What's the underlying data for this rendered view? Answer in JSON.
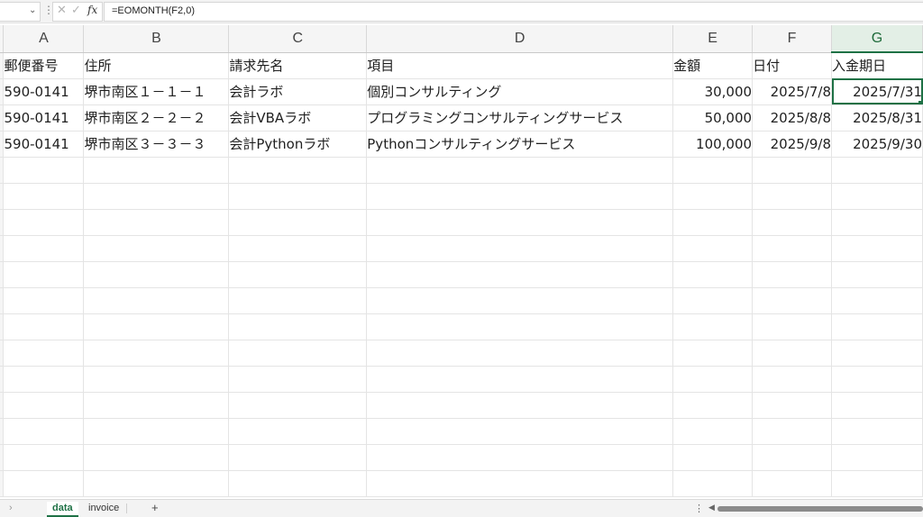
{
  "formula_bar": {
    "name_box": "",
    "formula": "=EOMONTH(F2,0)",
    "fx_label": "fx",
    "cancel_icon": "✕",
    "enter_icon": "✓"
  },
  "columns": [
    "A",
    "B",
    "C",
    "D",
    "E",
    "F",
    "G"
  ],
  "selected_column": "G",
  "headers": {
    "a": "郵便番号",
    "b": "住所",
    "c": "請求先名",
    "d": "項目",
    "e": "金額",
    "f": "日付",
    "g": "入金期日"
  },
  "rows": [
    {
      "a": "590-0141",
      "b": "堺市南区１－１－１",
      "c": "会計ラボ",
      "d": "個別コンサルティング",
      "e": "30,000",
      "f": "2025/7/8",
      "g": "2025/7/31"
    },
    {
      "a": "590-0141",
      "b": "堺市南区２－２－２",
      "c": "会計VBAラボ",
      "d": "プログラミングコンサルティングサービス",
      "e": "50,000",
      "f": "2025/8/8",
      "g": "2025/8/31"
    },
    {
      "a": "590-0141",
      "b": "堺市南区３－３－３",
      "c": "会計Pythonラボ",
      "d": "Pythonコンサルティングサービス",
      "e": "100,000",
      "f": "2025/9/8",
      "g": "2025/9/30"
    }
  ],
  "sheet_tabs": {
    "active": "data",
    "other": "invoice",
    "add_label": "+"
  },
  "colors": {
    "accent": "#1e7145",
    "grid_line": "#e4e4e4",
    "header_bg": "#f5f5f5"
  }
}
